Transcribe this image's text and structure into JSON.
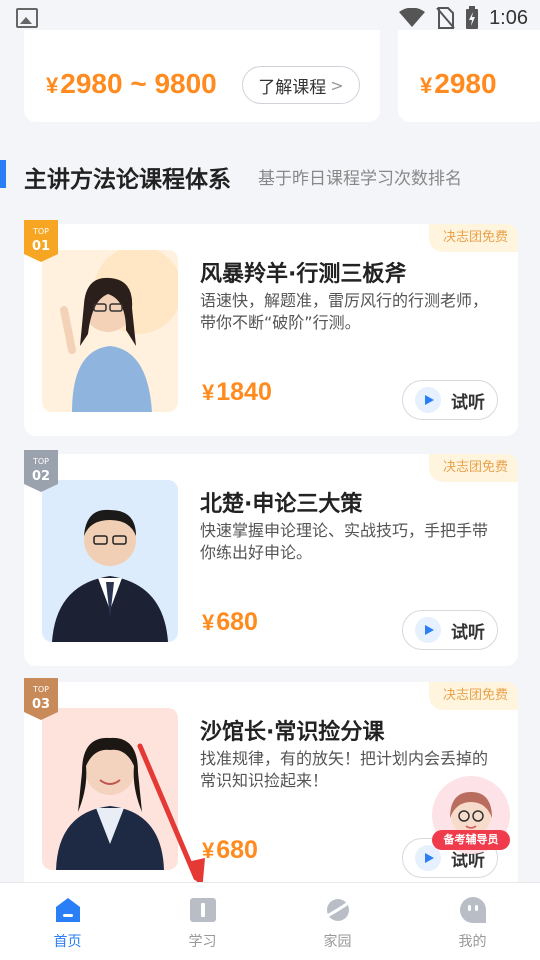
{
  "status_bar": {
    "time": "1:06"
  },
  "top_cards": [
    {
      "price": "2980 ~ 9800",
      "currency": "¥",
      "button": "了解课程"
    },
    {
      "price": "2980",
      "currency": "¥"
    }
  ],
  "section": {
    "title": "主讲方法论课程体系",
    "subtitle": "基于昨日课程学习次数排名"
  },
  "courses": [
    {
      "rank": "01",
      "rank_prefix": "TOP",
      "tag": "决志团免费",
      "name": "风暴羚羊·行测三板斧",
      "desc": "语速快，解题准，雷厉风行的行测老师，带你不断“破阶”行测。",
      "currency": "¥",
      "price": "1840",
      "listen": "试听",
      "badge_color": "#f6a623"
    },
    {
      "rank": "02",
      "rank_prefix": "TOP",
      "tag": "决志团免费",
      "name": "北楚·申论三大策",
      "desc": "快速掌握申论理论、实战技巧，手把手带你练出好申论。",
      "currency": "¥",
      "price": "680",
      "listen": "试听",
      "badge_color": "#9aa3ad"
    },
    {
      "rank": "03",
      "rank_prefix": "TOP",
      "tag": "决志团免费",
      "name": "沙馆长·常识捡分课",
      "desc": "找准规律，有的放矢！把计划内会丢掉的常识知识捡起来！",
      "currency": "¥",
      "price": "680",
      "listen": "试听",
      "badge_color": "#c98a5a"
    }
  ],
  "assistant": {
    "label": "备考辅导员"
  },
  "tabs": [
    {
      "label": "首页",
      "active": true
    },
    {
      "label": "学习",
      "active": false
    },
    {
      "label": "家园",
      "active": false
    },
    {
      "label": "我的",
      "active": false
    }
  ],
  "colors": {
    "accent": "#2a7ef6",
    "price": "#ff8a1e",
    "free_tag": "#e8a24a",
    "arrow": "#e53935"
  }
}
